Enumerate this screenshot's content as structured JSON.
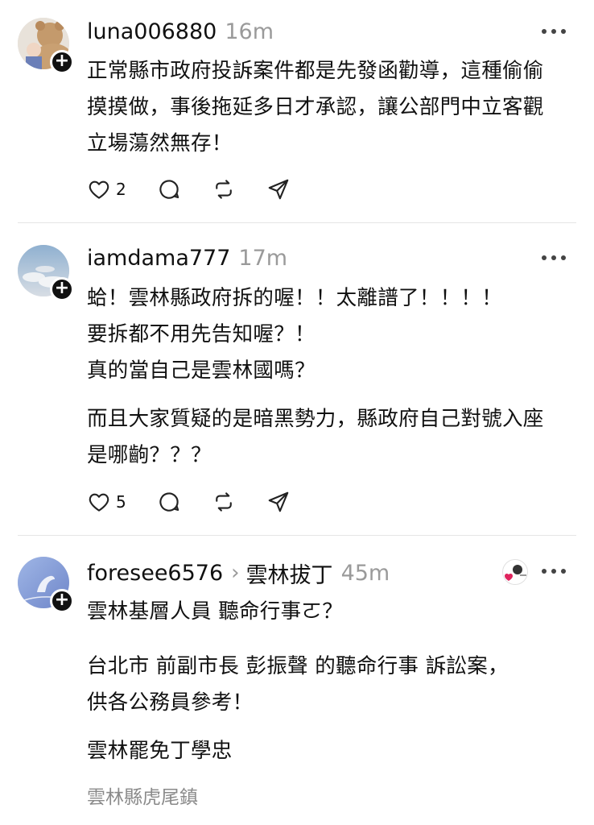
{
  "posts": [
    {
      "username": "luna006880",
      "time": "16m",
      "lines": [
        "正常縣市政府投訴案件都是先發函勸導，這種偷偷",
        "摸摸做，事後拖延多日才承認，讓公部門中立客觀",
        "立場蕩然無存！"
      ],
      "likes": "2",
      "avatar_icon": "bear-avatar-icon"
    },
    {
      "username": "iamdama777",
      "time": "17m",
      "lines": [
        "蛤！雲林縣政府拆的喔！！太離譜了！！！！",
        "要拆都不用先告知喔？！",
        "真的當自己是雲林國嗎？"
      ],
      "lines2": [
        "而且大家質疑的是暗黑勢力，縣政府自己對號入座",
        "是哪齣？？？"
      ],
      "likes": "5",
      "avatar_icon": "sky-avatar-icon"
    },
    {
      "username": "foresee6576",
      "topic": "雲林拔丁",
      "time": "45m",
      "lines": [
        "雲林基層人員 聽命行事ㄛ？"
      ],
      "lines2": [
        "台北市 前副市長 彭振聲 的聽命行事 訴訟案，",
        "供各公務員參考！"
      ],
      "lines3": [
        "雲林罷免丁學忠"
      ],
      "location": "雲林縣虎尾鎮",
      "avatar_icon": "bird-avatar-icon",
      "badge_icon": "heart-badge-icon"
    }
  ],
  "colors": {
    "text": "#111111",
    "muted": "#9a9a9a",
    "divider": "#e5e5e5",
    "heart": "#e0245e"
  }
}
